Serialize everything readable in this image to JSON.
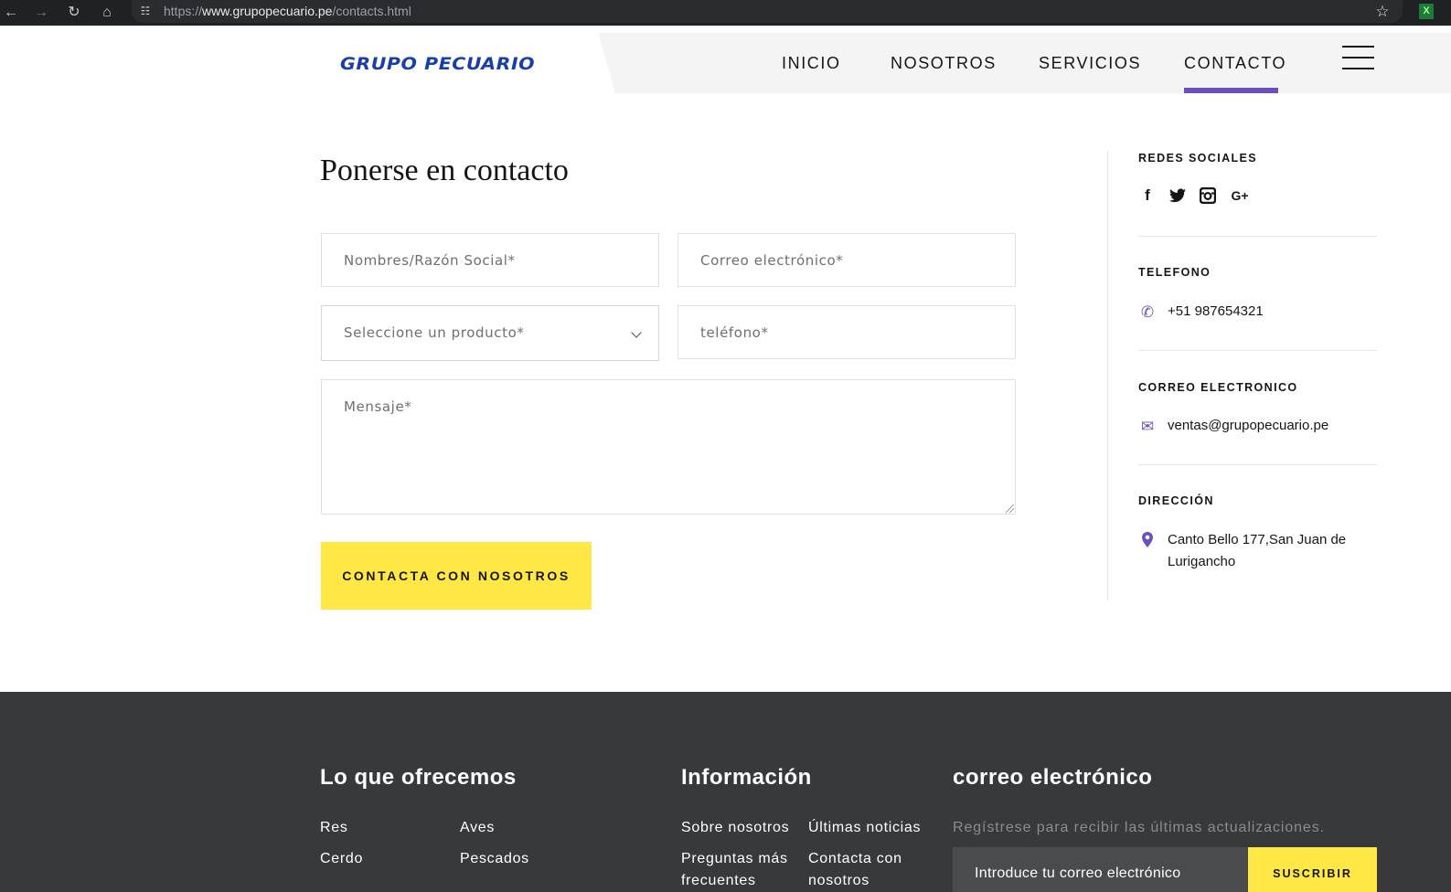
{
  "browser": {
    "url_scheme": "https://",
    "url_host": "www.grupopecuario.pe",
    "url_path": "/contacts.html",
    "back_icon": "←",
    "forward_icon": "→",
    "reload_icon": "↻",
    "home_icon": "⌂",
    "site_info_icon": "☷",
    "bookmark_icon": "☆",
    "extension_icon": "X"
  },
  "header": {
    "logo_text": "GRUPO PECUARIO",
    "nav": [
      {
        "label": "INICIO"
      },
      {
        "label": "NOSOTROS"
      },
      {
        "label": "SERVICIOS"
      },
      {
        "label": "CONTACTO"
      }
    ],
    "active_nav": "CONTACTO",
    "accent_color": "#6b4fbb"
  },
  "form": {
    "title": "Ponerse en contacto",
    "name_placeholder": "Nombres/Razón Social*",
    "email_placeholder": "Correo electrónico*",
    "product_select_value": "Seleccione un producto*",
    "phone_placeholder": "teléfono*",
    "message_placeholder": "Mensaje*",
    "submit_label": "CONTACTA CON NOSOTROS",
    "button_color": "#ffe845"
  },
  "sidebar": {
    "social_title": "REDES SOCIALES",
    "social_icons": [
      {
        "name": "facebook-icon",
        "glyph": "f"
      },
      {
        "name": "twitter-icon",
        "glyph": "🐦"
      },
      {
        "name": "instagram-icon",
        "glyph": "◙"
      },
      {
        "name": "google-plus-icon",
        "glyph": "G+"
      }
    ],
    "phone_title": "TELEFONO",
    "phone_icon": "✆",
    "phone_value": "+51 987654321",
    "email_title": "CORREO ELECTRONICO",
    "email_icon": "✉",
    "email_value": "ventas@grupopecuario.pe",
    "address_title": "DIRECCIÓN",
    "address_icon": "⚲",
    "address_line1": "Canto Bello 177,San Juan de",
    "address_line2": "Lurigancho"
  },
  "footer": {
    "offer_title": "Lo que ofrecemos",
    "offer_links": [
      "Res",
      "Aves",
      "Cerdo",
      "Pescados"
    ],
    "info_title": "Información",
    "info_links": [
      "Sobre nosotros",
      "Últimas noticias",
      "Preguntas más",
      "Contacta con"
    ],
    "info_links_line2": [
      "frecuentes",
      "nosotros"
    ],
    "newsletter_title": "correo electrónico",
    "newsletter_subtitle": "Regístrese para recibir las últimas actualizaciones.",
    "newsletter_input": "Introduce tu correo electrónico",
    "newsletter_button": "SUSCRIBIR",
    "background_color": "#38393b"
  }
}
